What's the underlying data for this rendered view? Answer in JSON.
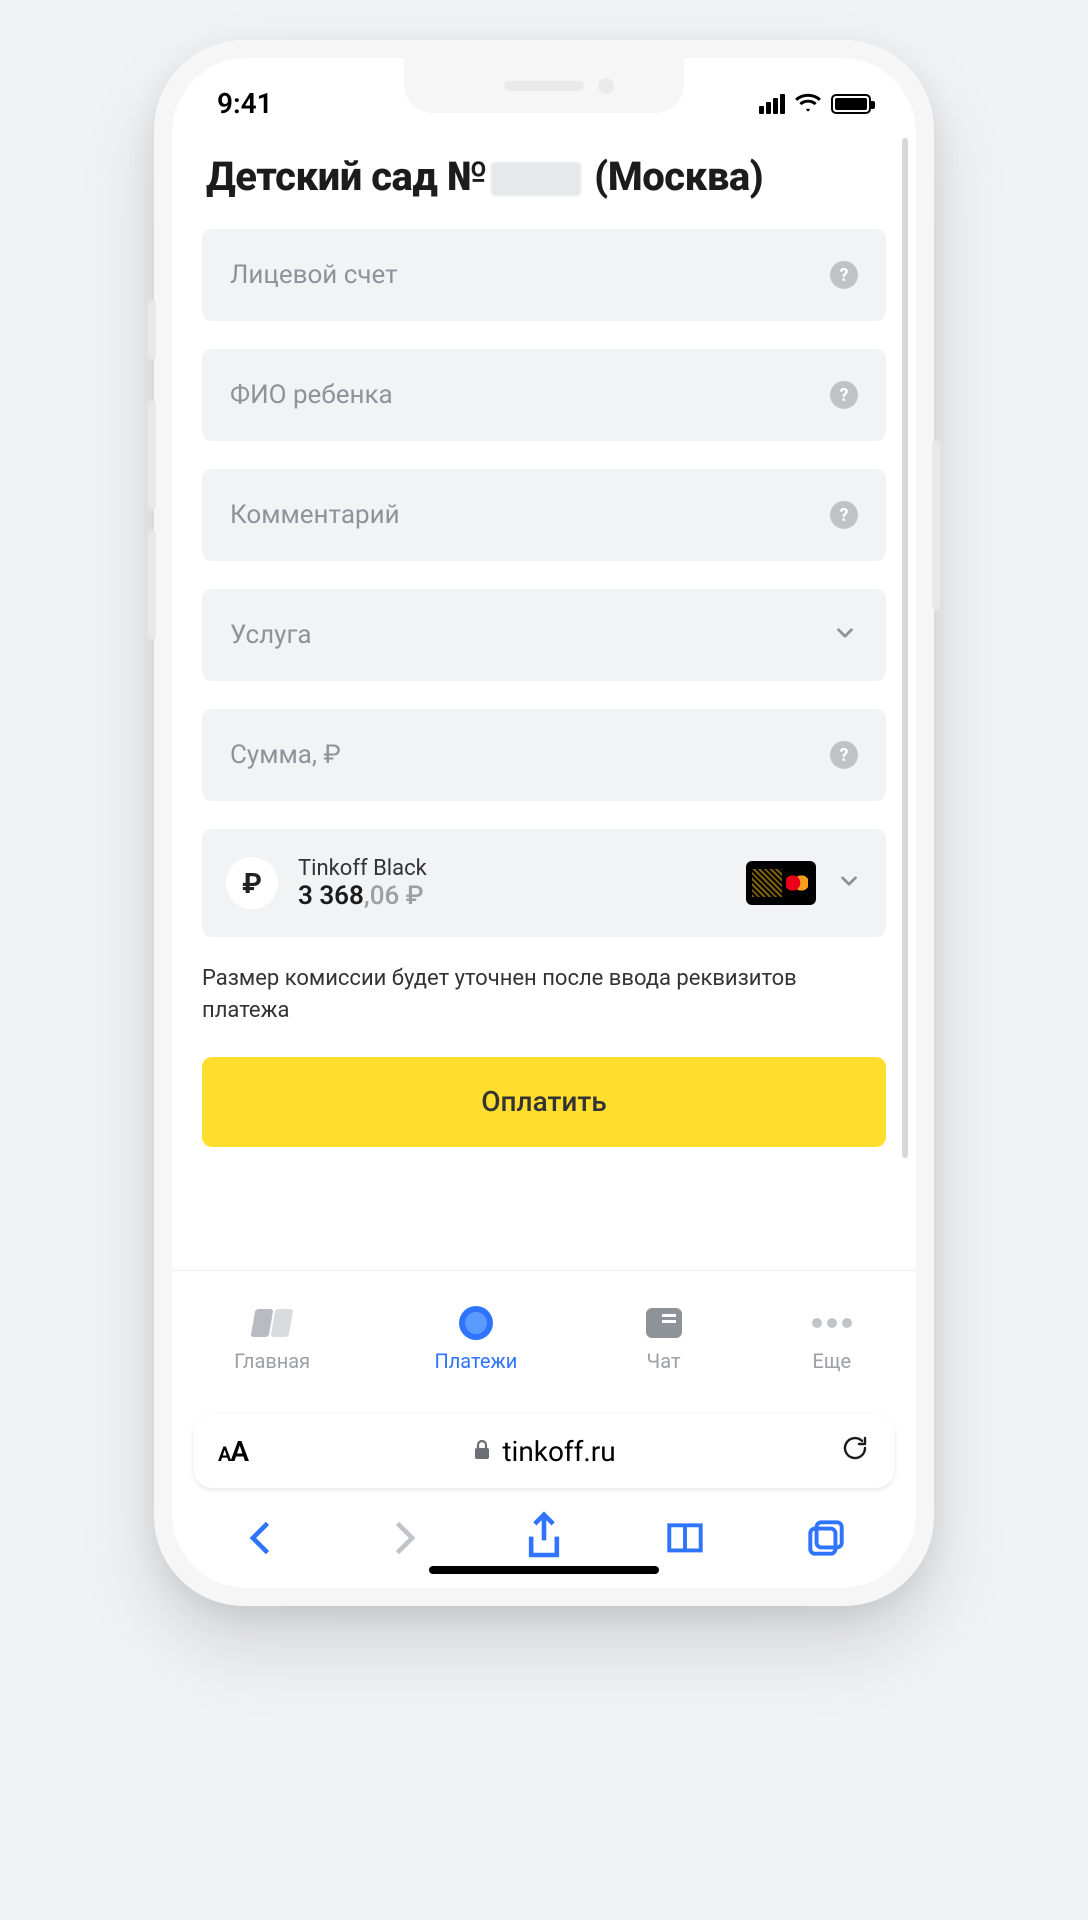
{
  "status": {
    "time": "9:41"
  },
  "page": {
    "title_prefix": "Детский сад №",
    "title_suffix": " (Москва)"
  },
  "fields": {
    "account": {
      "label": "Лицевой счет"
    },
    "child": {
      "label": "ФИО ребенка"
    },
    "comment": {
      "label": "Комментарий"
    },
    "service": {
      "label": "Услуга"
    },
    "amount": {
      "label": "Сумма, ₽"
    }
  },
  "card": {
    "name": "Tinkoff Black",
    "balance_main": "3 368",
    "balance_cents": ",06 ₽"
  },
  "commission_note": "Размер комиссии будет уточнен после ввода реквизитов платежа",
  "pay_label": "Оплатить",
  "tabs": {
    "home": "Главная",
    "pay": "Платежи",
    "chat": "Чат",
    "more": "Еще"
  },
  "browser": {
    "domain": "tinkoff.ru"
  }
}
